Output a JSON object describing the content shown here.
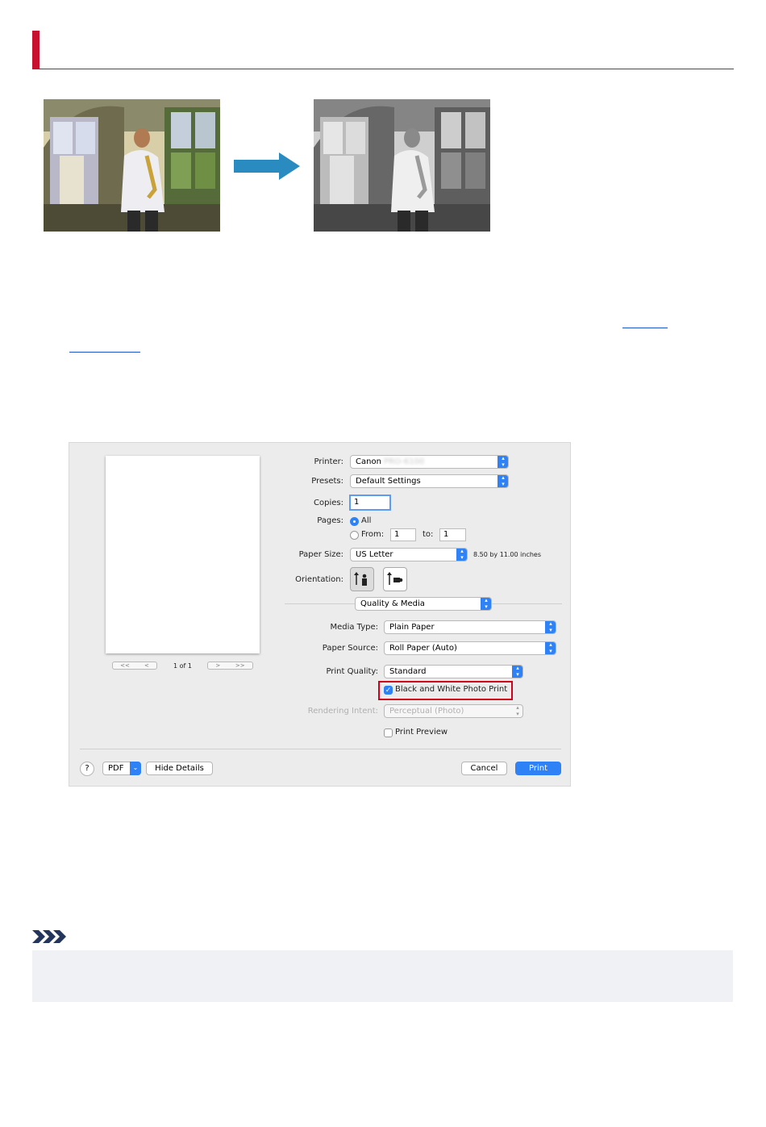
{
  "dialog": {
    "preview": {
      "page_indicator": "1 of 1",
      "first_label": "<<",
      "prev_label": "<",
      "next_label": ">",
      "last_label": ">>"
    },
    "printer": {
      "label": "Printer:",
      "value": "Canon",
      "blurred": "PRO-6100"
    },
    "presets": {
      "label": "Presets:",
      "value": "Default Settings"
    },
    "copies": {
      "label": "Copies:",
      "value": "1"
    },
    "pages": {
      "label": "Pages:",
      "all_label": "All",
      "from_label": "From:",
      "from_value": "1",
      "to_label": "to:",
      "to_value": "1"
    },
    "paper_size": {
      "label": "Paper Size:",
      "value": "US Letter",
      "dimensions": "8.50 by 11.00 inches"
    },
    "orientation": {
      "label": "Orientation:"
    },
    "section": {
      "value": "Quality & Media"
    },
    "media_type": {
      "label": "Media Type:",
      "value": "Plain Paper"
    },
    "paper_source": {
      "label": "Paper Source:",
      "value": "Roll Paper (Auto)"
    },
    "print_quality": {
      "label": "Print Quality:",
      "value": "Standard"
    },
    "bw_photo": {
      "label": "Black and White Photo Print",
      "checked": true
    },
    "rendering_intent": {
      "label": "Rendering Intent:",
      "value": "Perceptual (Photo)"
    },
    "print_preview": {
      "label": "Print Preview",
      "checked": false
    },
    "footer": {
      "help": "?",
      "pdf": "PDF",
      "hide_details": "Hide Details",
      "cancel": "Cancel",
      "print": "Print"
    }
  },
  "colors": {
    "accent_red": "#c8102e",
    "arrow_blue": "#2a8bc0",
    "mac_blue": "#2f82f6",
    "highlight_red": "#d0021b",
    "note_box": "#f0f1f5"
  }
}
